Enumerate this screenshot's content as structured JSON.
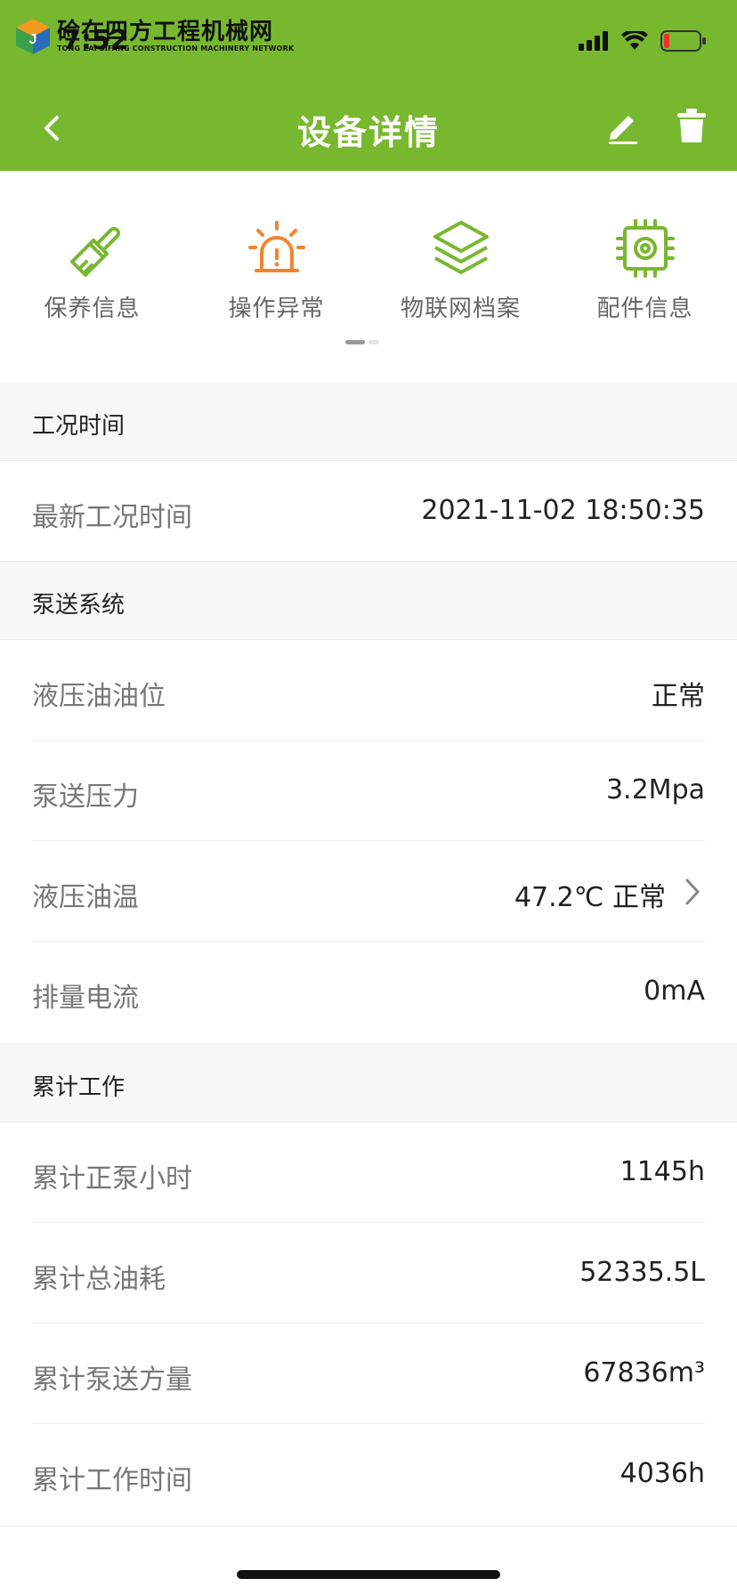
{
  "status_bar": {
    "time": "7:52",
    "watermark_cn": "硷在四方工程机械网",
    "watermark_en": "TONG ZAI SIFANG CONSTRUCTION MACHINERY NETWORK"
  },
  "nav": {
    "title": "设备详情",
    "back_icon": "chevron-left-icon",
    "edit_icon": "pencil-icon",
    "delete_icon": "trash-icon"
  },
  "quick_menu": [
    {
      "label": "保养信息",
      "icon": "brush-icon",
      "color": "#78b82f"
    },
    {
      "label": "操作异常",
      "icon": "alarm-icon",
      "color": "#f0852d"
    },
    {
      "label": "物联网档案",
      "icon": "layers-icon",
      "color": "#78b82f"
    },
    {
      "label": "配件信息",
      "icon": "chip-gear-icon",
      "color": "#78b82f"
    }
  ],
  "sections": {
    "work_time": {
      "title": "工况时间",
      "rows": [
        {
          "label": "最新工况时间",
          "value": "2021-11-02 18:50:35"
        }
      ]
    },
    "pump_system": {
      "title": "泵送系统",
      "rows": [
        {
          "label": "液压油油位",
          "value": "正常"
        },
        {
          "label": "泵送压力",
          "value": "3.2Mpa"
        },
        {
          "label": "液压油温",
          "value": "47.2℃ 正常"
        },
        {
          "label": "排量电流",
          "value": "0mA"
        }
      ]
    },
    "cumulative": {
      "title": "累计工作",
      "rows": [
        {
          "label": "累计正泵小时",
          "value": "1145h"
        },
        {
          "label": "累计总油耗",
          "value": "52335.5L"
        },
        {
          "label": "累计泵送方量",
          "value": "67836m³"
        },
        {
          "label": "累计工作时间",
          "value": "4036h"
        }
      ]
    }
  },
  "colors": {
    "brand_green": "#78b82f",
    "warning_orange": "#f0852d"
  }
}
